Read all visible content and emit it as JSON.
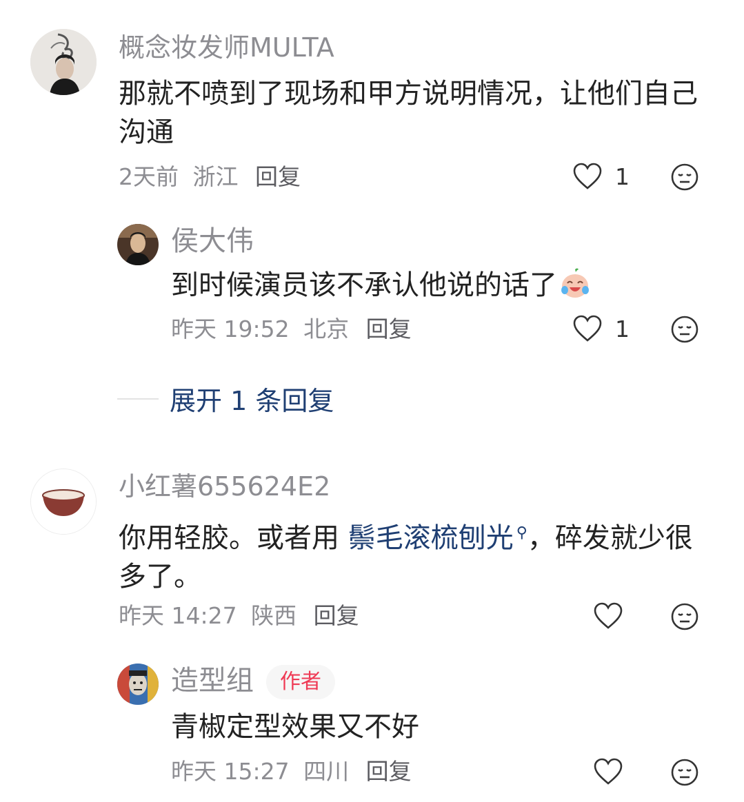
{
  "comments": [
    {
      "username": "概念妆发师MULTA",
      "text": "那就不喷到了现场和甲方说明情况，让他们自己沟通",
      "date": "2天前",
      "location": "浙江",
      "reply_label": "回复",
      "like_count": "1",
      "replies": [
        {
          "username": "侯大伟",
          "text": "到时候演员该不承认他说的话了",
          "date": "昨天 19:52",
          "location": "北京",
          "reply_label": "回复",
          "like_count": "1"
        }
      ],
      "expand_label": "展开 1 条回复"
    },
    {
      "username": "小红薯655624E2",
      "text_before": "你用轻胶。或者用 ",
      "link_text": "鬃毛滚梳刨光",
      "text_after": "，碎发就少很多了。",
      "date": "昨天 14:27",
      "location": "陕西",
      "reply_label": "回复",
      "like_count": "",
      "replies": [
        {
          "username": "造型组",
          "badge": "作者",
          "text": "青椒定型效果又不好",
          "date": "昨天 15:27",
          "location": "四川",
          "reply_label": "回复",
          "like_count": ""
        }
      ]
    }
  ],
  "icons": {
    "like": "heart-outline-icon",
    "dislike": "neutral-face-icon",
    "search": "search-icon",
    "emoji": "crying-laughing-emoji"
  },
  "colors": {
    "link": "#1f3f73",
    "badge_text": "#ef3a55",
    "muted": "#8d8d92"
  }
}
